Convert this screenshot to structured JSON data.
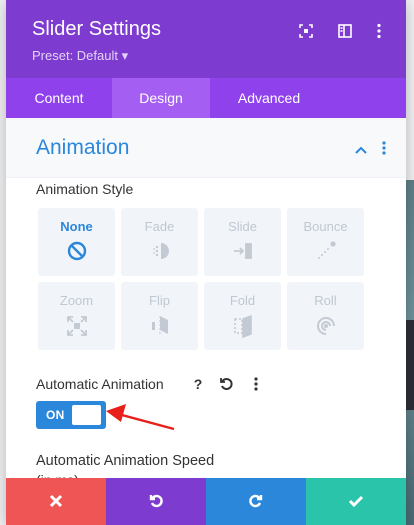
{
  "header": {
    "title": "Slider Settings",
    "preset": "Preset: Default ▾",
    "icons": [
      "focus-icon",
      "sidebar-toggle-icon",
      "more-vertical-icon"
    ]
  },
  "tabs": [
    {
      "label": "Content",
      "active": false
    },
    {
      "label": "Design",
      "active": true
    },
    {
      "label": "Advanced",
      "active": false
    }
  ],
  "section": {
    "title": "Animation"
  },
  "animation_style": {
    "label": "Animation Style",
    "selected": "None",
    "options": [
      {
        "label": "None",
        "icon": "none-circle-icon"
      },
      {
        "label": "Fade",
        "icon": "fade-icon"
      },
      {
        "label": "Slide",
        "icon": "slide-icon"
      },
      {
        "label": "Bounce",
        "icon": "bounce-icon"
      },
      {
        "label": "Zoom",
        "icon": "zoom-icon"
      },
      {
        "label": "Flip",
        "icon": "flip-icon"
      },
      {
        "label": "Fold",
        "icon": "fold-icon"
      },
      {
        "label": "Roll",
        "icon": "roll-icon"
      }
    ]
  },
  "automatic_animation": {
    "label": "Automatic Animation",
    "help": "?",
    "toggle_label": "ON",
    "toggle_on": true
  },
  "speed": {
    "label": "Automatic Animation Speed",
    "sublabel": "(in ms)"
  },
  "footer": {
    "buttons": [
      {
        "name": "discard",
        "color": "#ef5555"
      },
      {
        "name": "undo",
        "color": "#7e3bd0"
      },
      {
        "name": "redo",
        "color": "#2b87da"
      },
      {
        "name": "save",
        "color": "#29c4a9"
      }
    ]
  },
  "colors": {
    "header": "#7e3bd0",
    "tabs": "#8f42ec",
    "tab_active": "#a45ef2",
    "accent_blue": "#2b87da"
  }
}
